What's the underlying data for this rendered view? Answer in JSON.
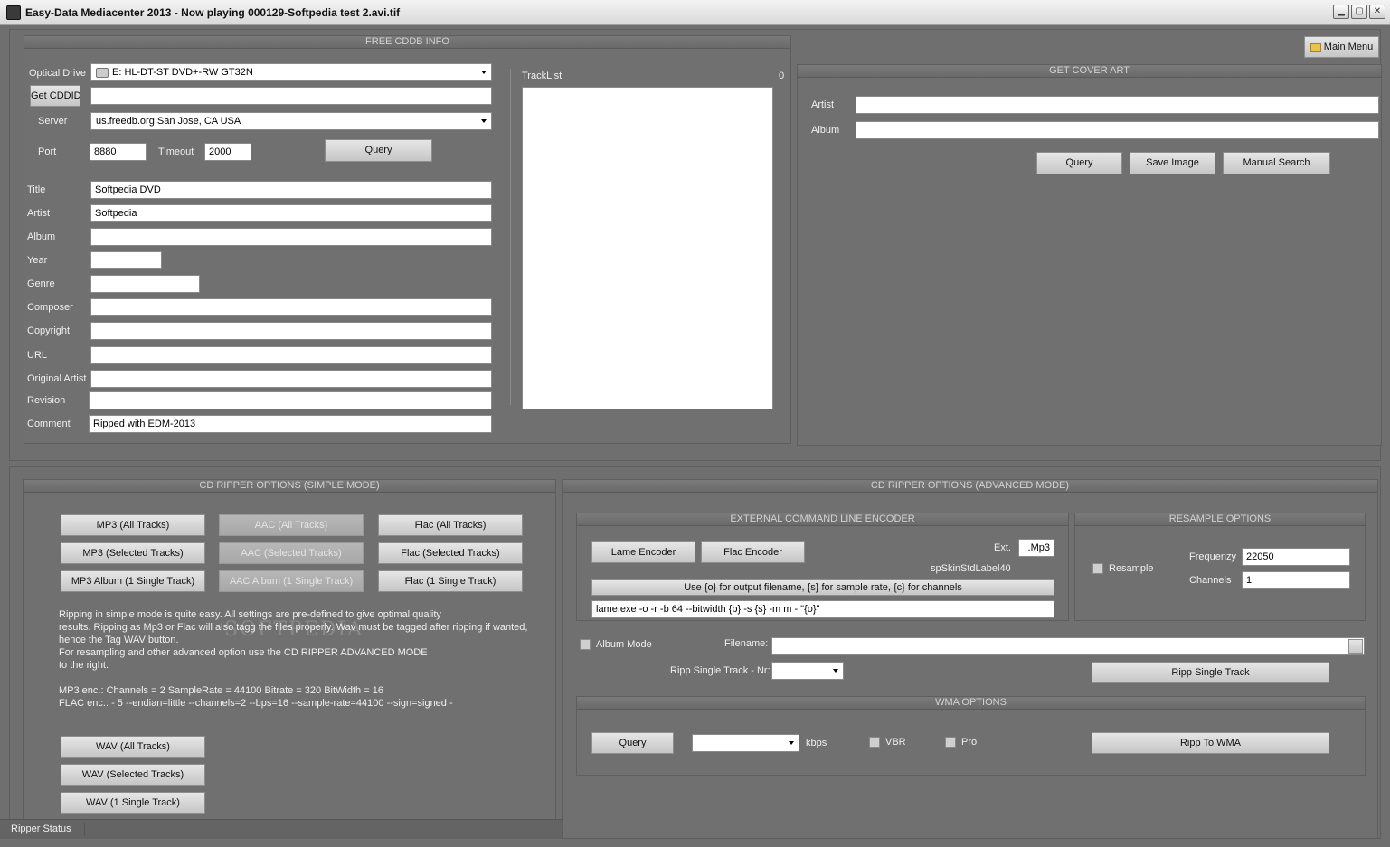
{
  "window": {
    "title": "Easy-Data Mediacenter 2013 - Now playing 000129-Softpedia test 2.avi.tif",
    "minimize": "▁",
    "maximize": "▢",
    "close": "✕"
  },
  "main_menu": {
    "label": "Main Menu",
    "icon": "folder-icon"
  },
  "cddb": {
    "title": "FREE CDDB INFO",
    "optical_drive_label": "Optical Drive",
    "optical_drive_value": "E: HL-DT-ST DVD+-RW GT32N",
    "get_cddid_label": "Get CDDID",
    "cddid_value": "",
    "server_label": "Server",
    "server_value": "us.freedb.org San Jose, CA USA",
    "port_label": "Port",
    "port_value": "8880",
    "timeout_label": "Timeout",
    "timeout_value": "2000",
    "query_label": "Query",
    "fields": {
      "title_label": "Title",
      "title_value": "Softpedia DVD",
      "artist_label": "Artist",
      "artist_value": "Softpedia",
      "album_label": "Album",
      "album_value": "",
      "year_label": "Year",
      "year_value": "",
      "genre_label": "Genre",
      "genre_value": "",
      "composer_label": "Composer",
      "composer_value": "",
      "copyright_label": "Copyright",
      "copyright_value": "",
      "url_label": "URL",
      "url_value": "",
      "original_artist_label": "Original Artist",
      "original_artist_value": "",
      "revision_label": "Revision",
      "revision_value": "",
      "comment_label": "Comment",
      "comment_value": "Ripped with EDM-2013"
    },
    "tracklist_label": "TrackList",
    "tracklist_count": "0"
  },
  "cover": {
    "title": "GET COVER ART",
    "artist_label": "Artist",
    "artist_value": "",
    "album_label": "Album",
    "album_value": "",
    "query_label": "Query",
    "save_label": "Save Image",
    "manual_label": "Manual Search"
  },
  "simple": {
    "title": "CD RIPPER OPTIONS (SIMPLE MODE)",
    "buttons": {
      "mp3_all": "MP3 (All Tracks)",
      "aac_all": "AAC (All Tracks)",
      "flac_all": "Flac (All Tracks)",
      "mp3_sel": "MP3 (Selected Tracks)",
      "aac_sel": "AAC (Selected Tracks)",
      "flac_sel": "Flac (Selected Tracks)",
      "mp3_album": "MP3 Album (1 Single Track)",
      "aac_album": "AAC Album (1 Single Track)",
      "flac_single": "Flac (1 Single Track)",
      "wav_all": "WAV (All Tracks)",
      "wav_sel": "WAV (Selected Tracks)",
      "wav_single": "WAV (1 Single Track)"
    },
    "info": {
      "line1": "Ripping in simple mode is quite easy. All settings are pre-defined to give optimal quality",
      "line2": "results. Ripping as Mp3 or Flac will also tagg the files properly. Wav must be tagged after ripping if wanted,",
      "line3": "hence the Tag WAV button.",
      "line4": "For resampling and other advanced option use the CD RIPPER ADVANCED MODE",
      "line5": "to the right.",
      "line6": "MP3 enc.:   Channels = 2 SampleRate = 44100 Bitrate = 320 BitWidth = 16",
      "line7": "FLAC enc.: - 5 --endian=little --channels=2 --bps=16 --sample-rate=44100 --sign=signed -"
    }
  },
  "advanced": {
    "title": "CD RIPPER OPTIONS (ADVANCED MODE)",
    "ext": {
      "title": "EXTERNAL COMMAND LINE ENCODER",
      "lame_label": "Lame Encoder",
      "flac_label": "Flac Encoder",
      "ext_label": "Ext.",
      "ext_value": ".Mp3",
      "skin_label": "spSkinStdLabel40",
      "hint": "Use {o} for output filename, {s} for sample rate, {c} for channels",
      "cmd_value": "lame.exe -o -r -b 64 --bitwidth {b} -s {s} -m m - \"{o}\""
    },
    "resample": {
      "title": "RESAMPLE OPTIONS",
      "resample_label": "Resample",
      "freq_label": "Frequenzy",
      "freq_value": "22050",
      "channels_label": "Channels",
      "channels_value": "1"
    },
    "album_mode_label": "Album Mode",
    "filename_label": "Filename:",
    "filename_value": "",
    "ripp_nr_label": "Ripp Single Track - Nr:",
    "ripp_nr_value": "",
    "ripp_single_label": "Ripp Single Track",
    "wma": {
      "title": "WMA OPTIONS",
      "query_label": "Query",
      "kbps_value": "",
      "kbps_label": "kbps",
      "vbr_label": "VBR",
      "pro_label": "Pro",
      "ripp_label": "Ripp To WMA"
    }
  },
  "status": {
    "label": "Ripper Status"
  },
  "watermark": "SOFTPEDIA"
}
